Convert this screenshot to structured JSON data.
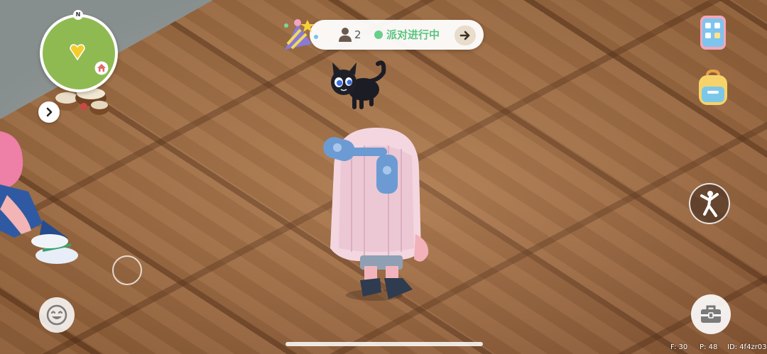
{
  "minimap": {
    "north_label": "N",
    "player_marker_icon": "heart-marker-icon",
    "home_marker_icon": "home-icon",
    "expand_icon": "chevron-right-icon"
  },
  "party": {
    "icon": "party-hat-icon",
    "player_icon": "person-icon",
    "player_count": "2",
    "status": "派对进行中",
    "status_color": "#5cc47f",
    "go_icon": "arrow-right-icon"
  },
  "side_menu": {
    "items": [
      {
        "name": "phone",
        "icon": "phone-icon"
      },
      {
        "name": "backpack",
        "icon": "backpack-icon"
      }
    ]
  },
  "actions": {
    "emote_icon": "dance-icon",
    "toolbox_icon": "toolbox-icon",
    "face_icon": "smile-emoji-icon"
  },
  "debug": {
    "fps": "F: 30",
    "ping": "P: 48",
    "id": "ID: 4f4zr03"
  }
}
